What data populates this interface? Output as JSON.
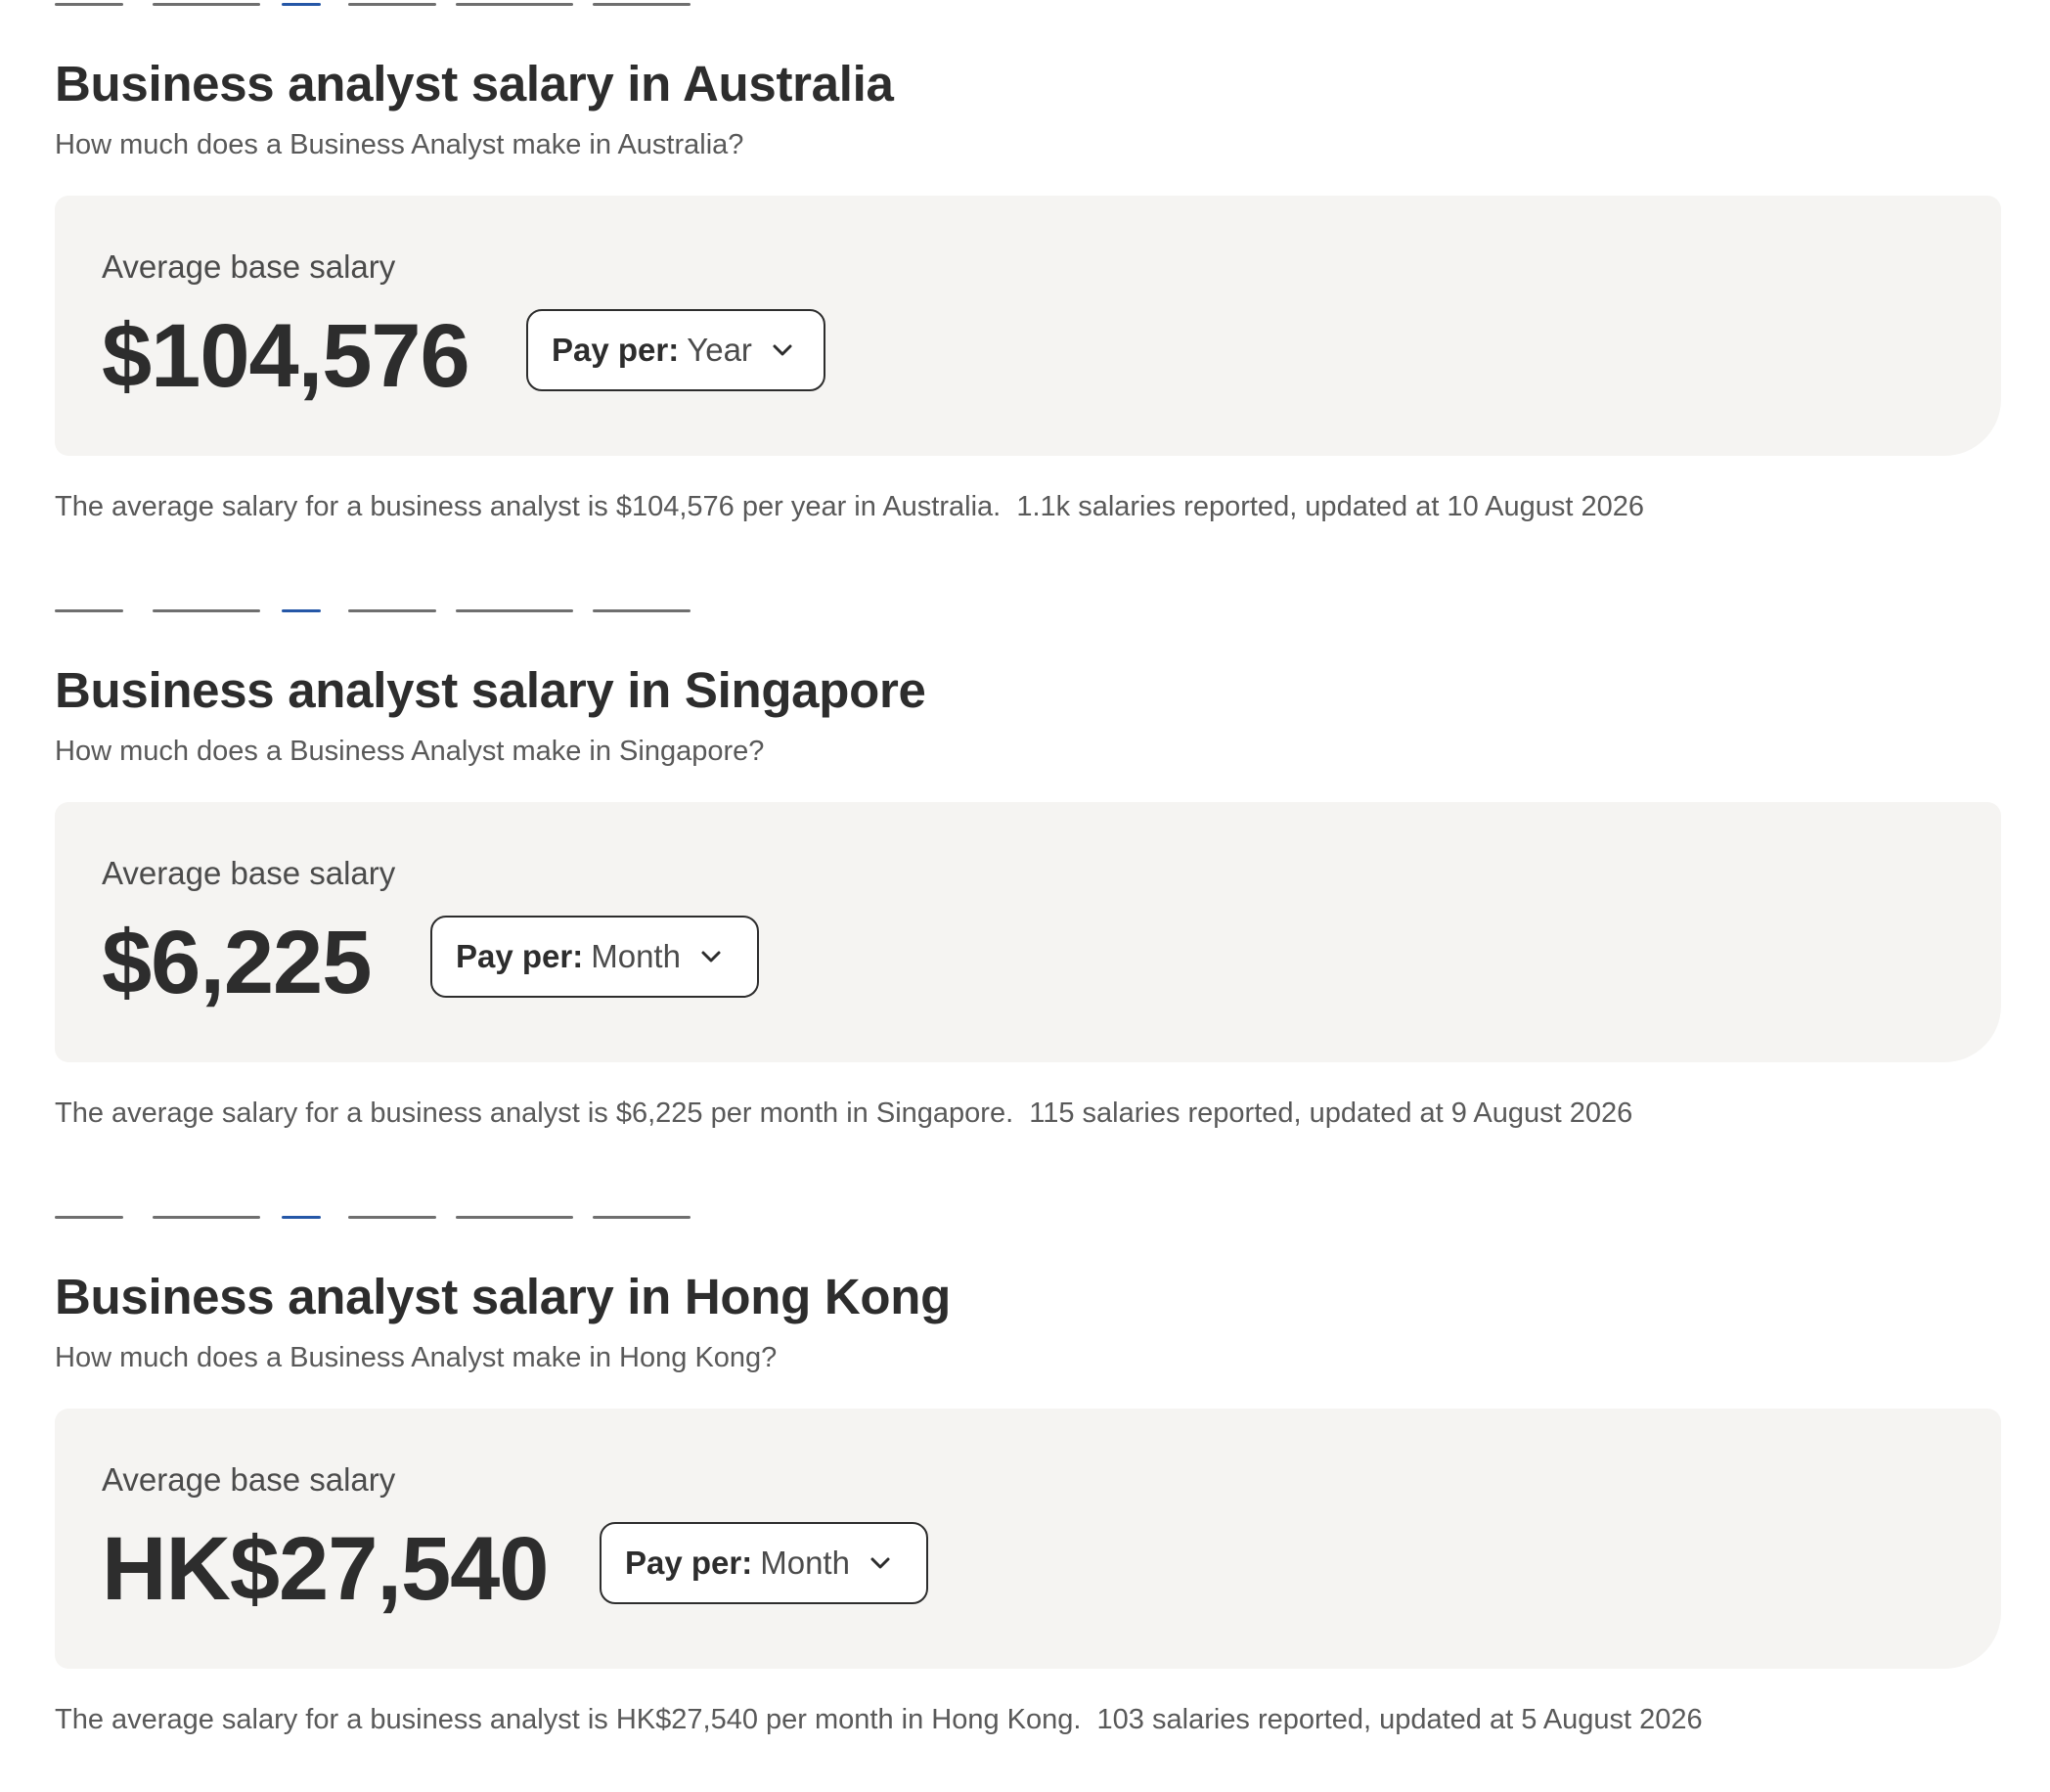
{
  "sections": [
    {
      "title": "Business analyst salary in Australia",
      "subtitle": "How much does a Business Analyst make in Australia?",
      "card_label": "Average base salary",
      "amount": "$104,576",
      "pay_per_label": "Pay per:",
      "pay_per_value": "Year",
      "footnote": "The average salary for a business analyst is $104,576 per year in Australia.  1.1k salaries reported, updated at 10 August 2026"
    },
    {
      "title": "Business analyst salary in Singapore",
      "subtitle": "How much does a Business Analyst make in Singapore?",
      "card_label": "Average base salary",
      "amount": "$6,225",
      "pay_per_label": "Pay per:",
      "pay_per_value": "Month",
      "footnote": "The average salary for a business analyst is $6,225 per month in Singapore.  115 salaries reported, updated at 9 August 2026"
    },
    {
      "title": "Business analyst salary in Hong Kong",
      "subtitle": "How much does a Business Analyst make in Hong Kong?",
      "card_label": "Average base salary",
      "amount": "HK$27,540",
      "pay_per_label": "Pay per:",
      "pay_per_value": "Month",
      "footnote": "The average salary for a business analyst is HK$27,540 per month in Hong Kong.  103 salaries reported, updated at 5 August 2026"
    }
  ],
  "icons": {
    "pay_per_dropdown": "chevron-down-icon"
  },
  "colors": {
    "text_primary": "#2d2d2d",
    "text_secondary": "#595959",
    "card_background": "#f5f4f2",
    "link_blue": "#2557a7"
  }
}
